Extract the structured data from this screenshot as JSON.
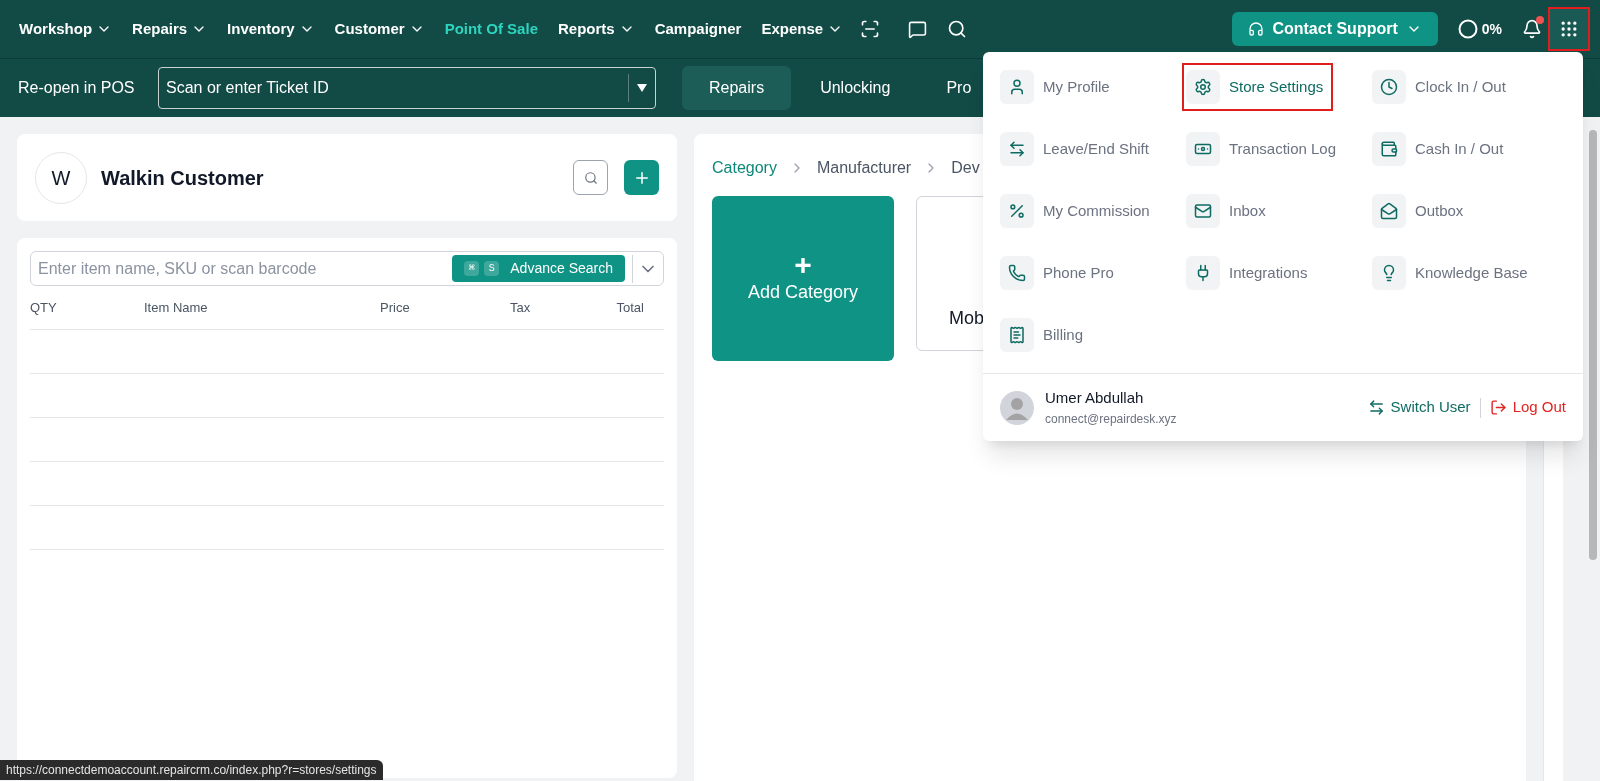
{
  "nav": {
    "items": [
      {
        "label": "Workshop",
        "has_menu": true,
        "selected": false
      },
      {
        "label": "Repairs",
        "has_menu": true,
        "selected": false
      },
      {
        "label": "Inventory",
        "has_menu": true,
        "selected": false
      },
      {
        "label": "Customer",
        "has_menu": true,
        "selected": false
      },
      {
        "label": "Point Of Sale",
        "has_menu": false,
        "selected": true
      },
      {
        "label": "Reports",
        "has_menu": true,
        "selected": false
      },
      {
        "label": "Campaigner",
        "has_menu": false,
        "selected": false
      },
      {
        "label": "Expense",
        "has_menu": true,
        "selected": false
      }
    ],
    "contact_support": "Contact Support",
    "progress": "0%",
    "notification_dot": true,
    "apps_button_highlighted": true
  },
  "subbar": {
    "reopen_label": "Re-open in POS",
    "ticket_field": {
      "value": "Scan or enter Ticket ID"
    },
    "tabs": [
      {
        "label": "Repairs",
        "selected": true
      },
      {
        "label": "Unlocking",
        "selected": false
      },
      {
        "label": "Pro",
        "selected": false
      }
    ]
  },
  "customer": {
    "initial": "W",
    "name": "Walkin Customer"
  },
  "item_search": {
    "placeholder": "Enter item name, SKU or scan barcode",
    "shortcut_keys": [
      "⌘",
      "S"
    ],
    "advance_search": "Advance Search"
  },
  "table": {
    "columns": [
      "QTY",
      "Item Name",
      "Price",
      "Tax",
      "Total"
    ]
  },
  "breadcrumb": [
    {
      "label": "Category",
      "selected": true
    },
    {
      "label": "Manufacturer",
      "selected": false
    },
    {
      "label": "Dev",
      "selected": false
    }
  ],
  "add_category": {
    "plus": "+",
    "label": "Add Category"
  },
  "category_cards": [
    {
      "label": "Mob"
    }
  ],
  "menu": {
    "items": [
      {
        "label": "My Profile",
        "highlighted": false
      },
      {
        "label": "Store Settings",
        "highlighted": true
      },
      {
        "label": "Clock In / Out",
        "highlighted": false
      },
      {
        "label": "Leave/End Shift",
        "highlighted": false
      },
      {
        "label": "Transaction Log",
        "highlighted": false
      },
      {
        "label": "Cash In / Out",
        "highlighted": false
      },
      {
        "label": "My Commission",
        "highlighted": false
      },
      {
        "label": "Inbox",
        "highlighted": false
      },
      {
        "label": "Outbox",
        "highlighted": false
      },
      {
        "label": "Phone Pro",
        "highlighted": false
      },
      {
        "label": "Integrations",
        "highlighted": false
      },
      {
        "label": "Knowledge Base",
        "highlighted": false
      },
      {
        "label": "Billing",
        "highlighted": false
      }
    ],
    "user": {
      "name": "Umer Abdullah",
      "email": "connect@repairdesk.xyz"
    },
    "switch_user": "Switch User",
    "log_out": "Log Out"
  },
  "status_url": "https://connectdemoaccount.repaircrm.co/index.php?r=stores/settings"
}
